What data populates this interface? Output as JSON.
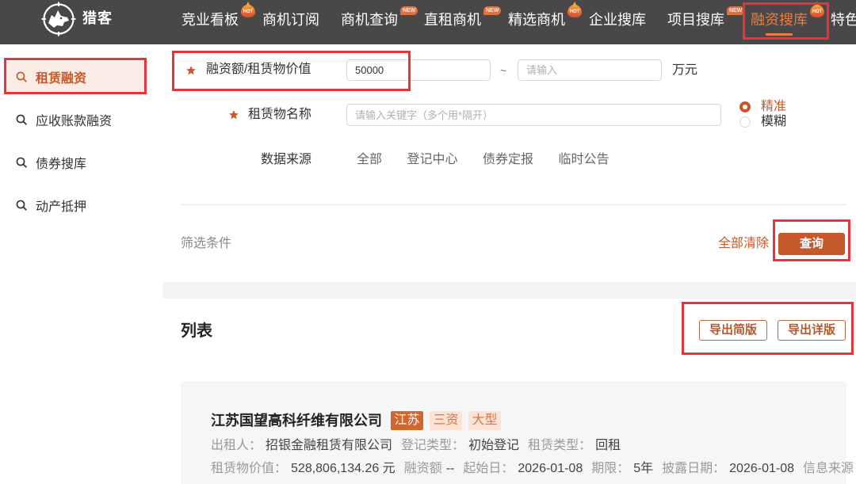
{
  "theme": {
    "accent": "#c6582b",
    "nav_bg": "#494747",
    "nav_active": "#ec7c46",
    "annotation": "#e8333a",
    "tag_filled_bg": "#d3652f",
    "tag_light_bg": "#fbe3d6",
    "tag_light_text": "#d9794b"
  },
  "brand": {
    "name": "猎客",
    "logo_icon": "wolf-crosshair-logo-icon"
  },
  "nav": {
    "items": [
      {
        "label": "竞业看板",
        "badge": "HOT"
      },
      {
        "label": "商机订阅"
      },
      {
        "label": "商机查询",
        "badge": "NEW"
      },
      {
        "label": "直租商机",
        "badge": "NEW"
      },
      {
        "label": "精选商机",
        "badge": "HOT"
      },
      {
        "label": "企业搜库"
      },
      {
        "label": "项目搜库",
        "badge": "NEW"
      },
      {
        "label": "融资搜库",
        "badge": "HOT",
        "active": true
      },
      {
        "label": "特色"
      }
    ]
  },
  "sidebar": {
    "items": [
      {
        "label": "租赁融资",
        "icon": "search-icon",
        "active": true
      },
      {
        "label": "应收账款融资",
        "icon": "search-icon"
      },
      {
        "label": "债券搜库",
        "icon": "search-icon"
      },
      {
        "label": "动产抵押",
        "icon": "search-icon"
      }
    ]
  },
  "filters": {
    "amount": {
      "label": "融资额/租赁物价值",
      "required": true,
      "min_value": "50000",
      "separator": "~",
      "max_placeholder": "请输入",
      "unit": "万元"
    },
    "asset_name": {
      "label": "租赁物名称",
      "required": true,
      "placeholder": "请输入关键字（多个用*隔开）",
      "match_options": [
        {
          "label": "精准",
          "selected": true
        },
        {
          "label": "模糊",
          "selected": false
        }
      ]
    },
    "source": {
      "label": "数据来源",
      "options": [
        "全部",
        "登记中心",
        "债券定报",
        "临时公告"
      ]
    },
    "conditions_label": "筛选条件",
    "clear_label": "全部清除",
    "search_label": "查询"
  },
  "list": {
    "title": "列表",
    "export_simple_label": "导出简版",
    "export_detail_label": "导出详版",
    "records": [
      {
        "company": "江苏国望高科纤维有限公司",
        "tags": [
          {
            "text": "江苏",
            "primary": true
          },
          {
            "text": "三资",
            "primary": false
          },
          {
            "text": "大型",
            "primary": false
          }
        ],
        "info_row_1": [
          {
            "label": "出租人：",
            "value": "招银金融租赁有限公司"
          },
          {
            "label": "登记类型：",
            "value": "初始登记"
          },
          {
            "label": "租赁类型：",
            "value": "回租"
          }
        ],
        "info_row_2": [
          {
            "label": "租赁物价值：",
            "value": "528,806,134.26 元"
          },
          {
            "label": "融资额",
            "value": "--"
          },
          {
            "label": "起始日：",
            "value": "2026-01-08"
          },
          {
            "label": "期限：",
            "value": "5年"
          },
          {
            "label": "披露日期：",
            "value": "2026-01-08"
          },
          {
            "label": "信息来源"
          }
        ]
      }
    ]
  }
}
